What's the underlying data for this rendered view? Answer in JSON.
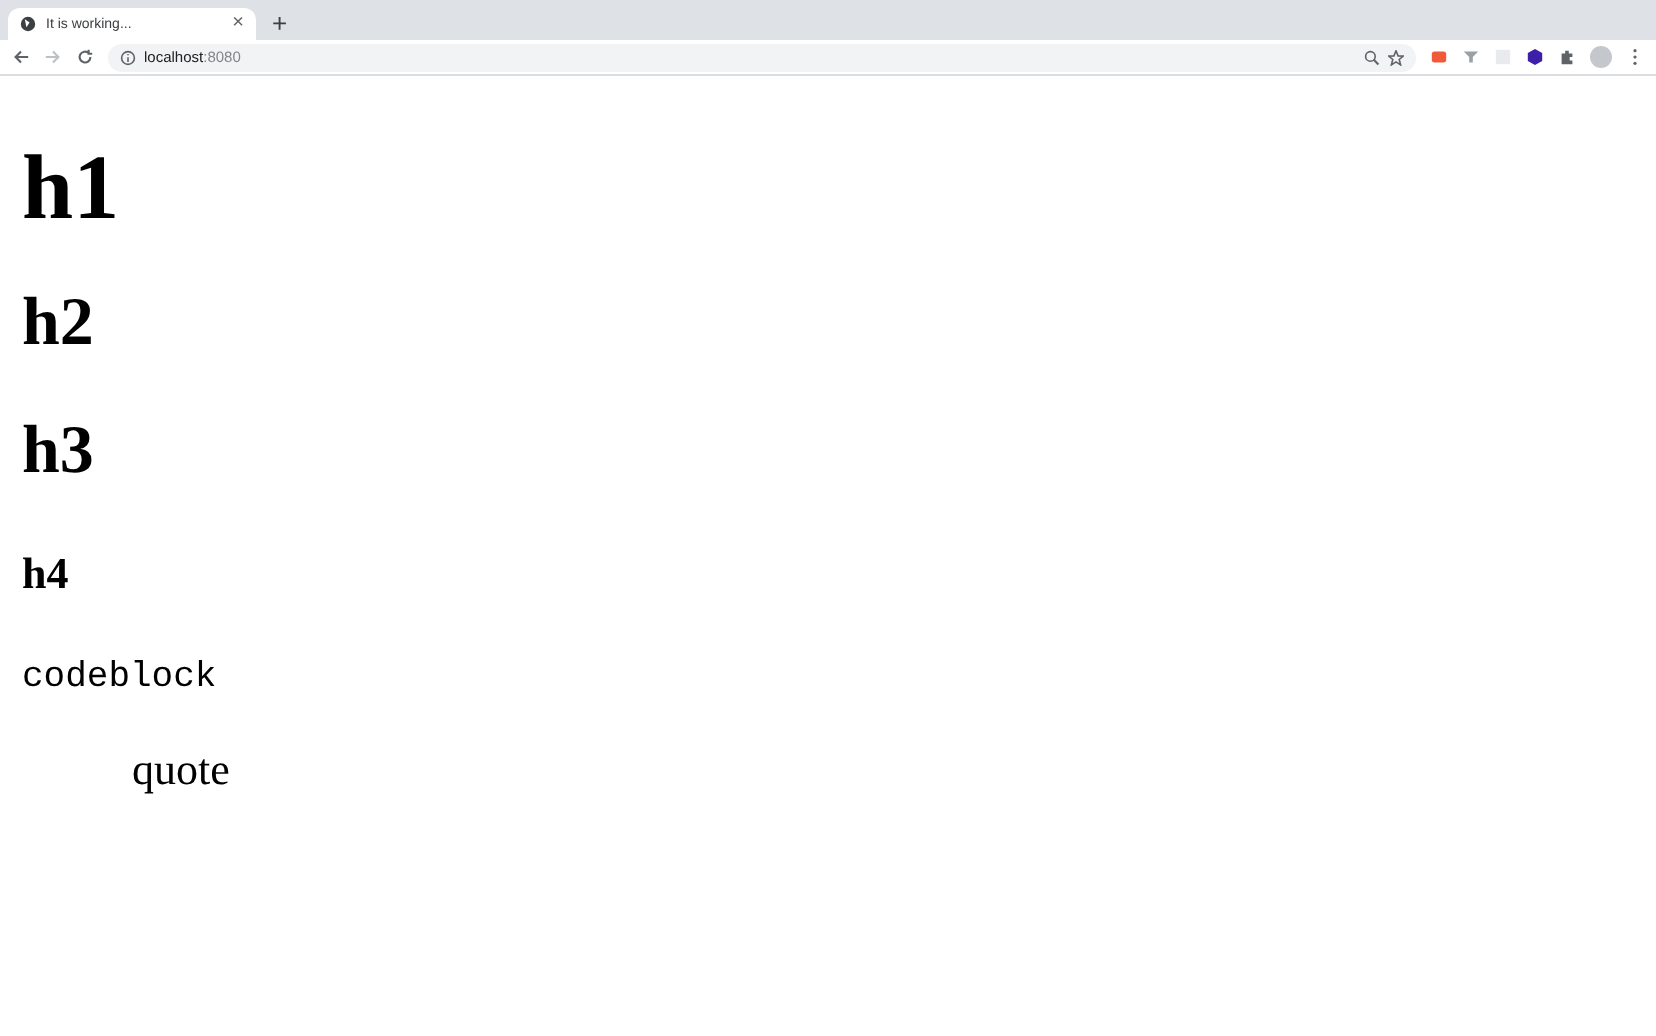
{
  "tab": {
    "title": "It is working...",
    "close": "×",
    "selected": true
  },
  "new_tab": "+",
  "address": {
    "host": "localhost",
    "port": ":8080"
  },
  "content": [
    {
      "kind": "h1",
      "text": "h1"
    },
    {
      "kind": "h2",
      "text": "h2"
    },
    {
      "kind": "h3",
      "text": "h3"
    },
    {
      "kind": "h4",
      "text": "h4"
    },
    {
      "kind": "code",
      "text": "codeblock"
    },
    {
      "kind": "quote",
      "text": "quote"
    }
  ]
}
